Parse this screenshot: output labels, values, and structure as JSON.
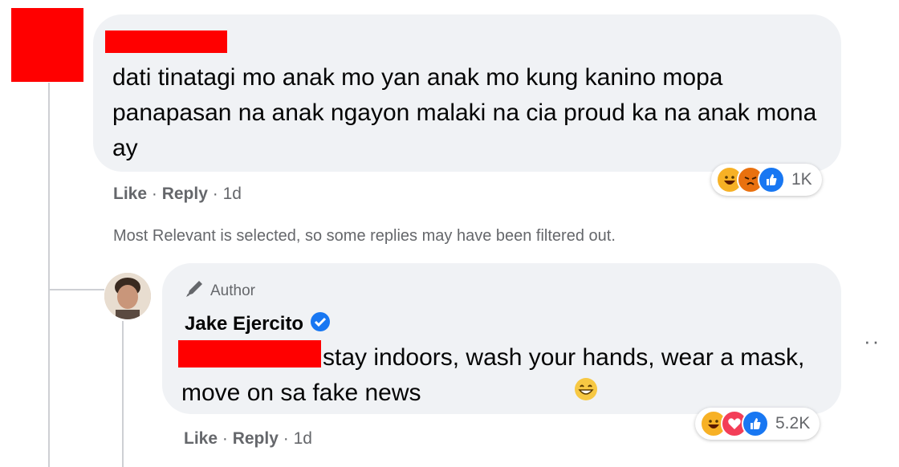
{
  "comment1": {
    "text": "dati tinatagi mo anak mo yan anak mo kung kanino mopa panapasan na anak ngayon malaki na cia proud ka na anak mona ay",
    "reaction_count": "1K",
    "actions": {
      "like": "Like",
      "reply": "Reply",
      "time": "1d"
    }
  },
  "filter_notice": "Most Relevant is selected, so some replies may have been filtered out.",
  "reply": {
    "author_tag": "Author",
    "name": "Jake Ejercito",
    "text": "stay indoors, wash your hands, wear a mask, move on sa fake news",
    "reaction_count": "5.2K",
    "actions": {
      "like": "Like",
      "reply": "Reply",
      "time": "1d"
    }
  },
  "icons": {
    "comment1_reactions": [
      "haha-icon",
      "angry-icon",
      "like-icon"
    ],
    "reply_reactions": [
      "haha-icon",
      "love-icon",
      "like-icon"
    ],
    "verified": "verified-badge-icon",
    "author": "pen-icon"
  },
  "colors": {
    "redaction": "#ff0000",
    "bubble": "#f0f2f5",
    "verified": "#1877f2",
    "like": "#1877f2",
    "love": "#f33e58",
    "haha": "#f7b125",
    "angry": "#e9710f"
  }
}
